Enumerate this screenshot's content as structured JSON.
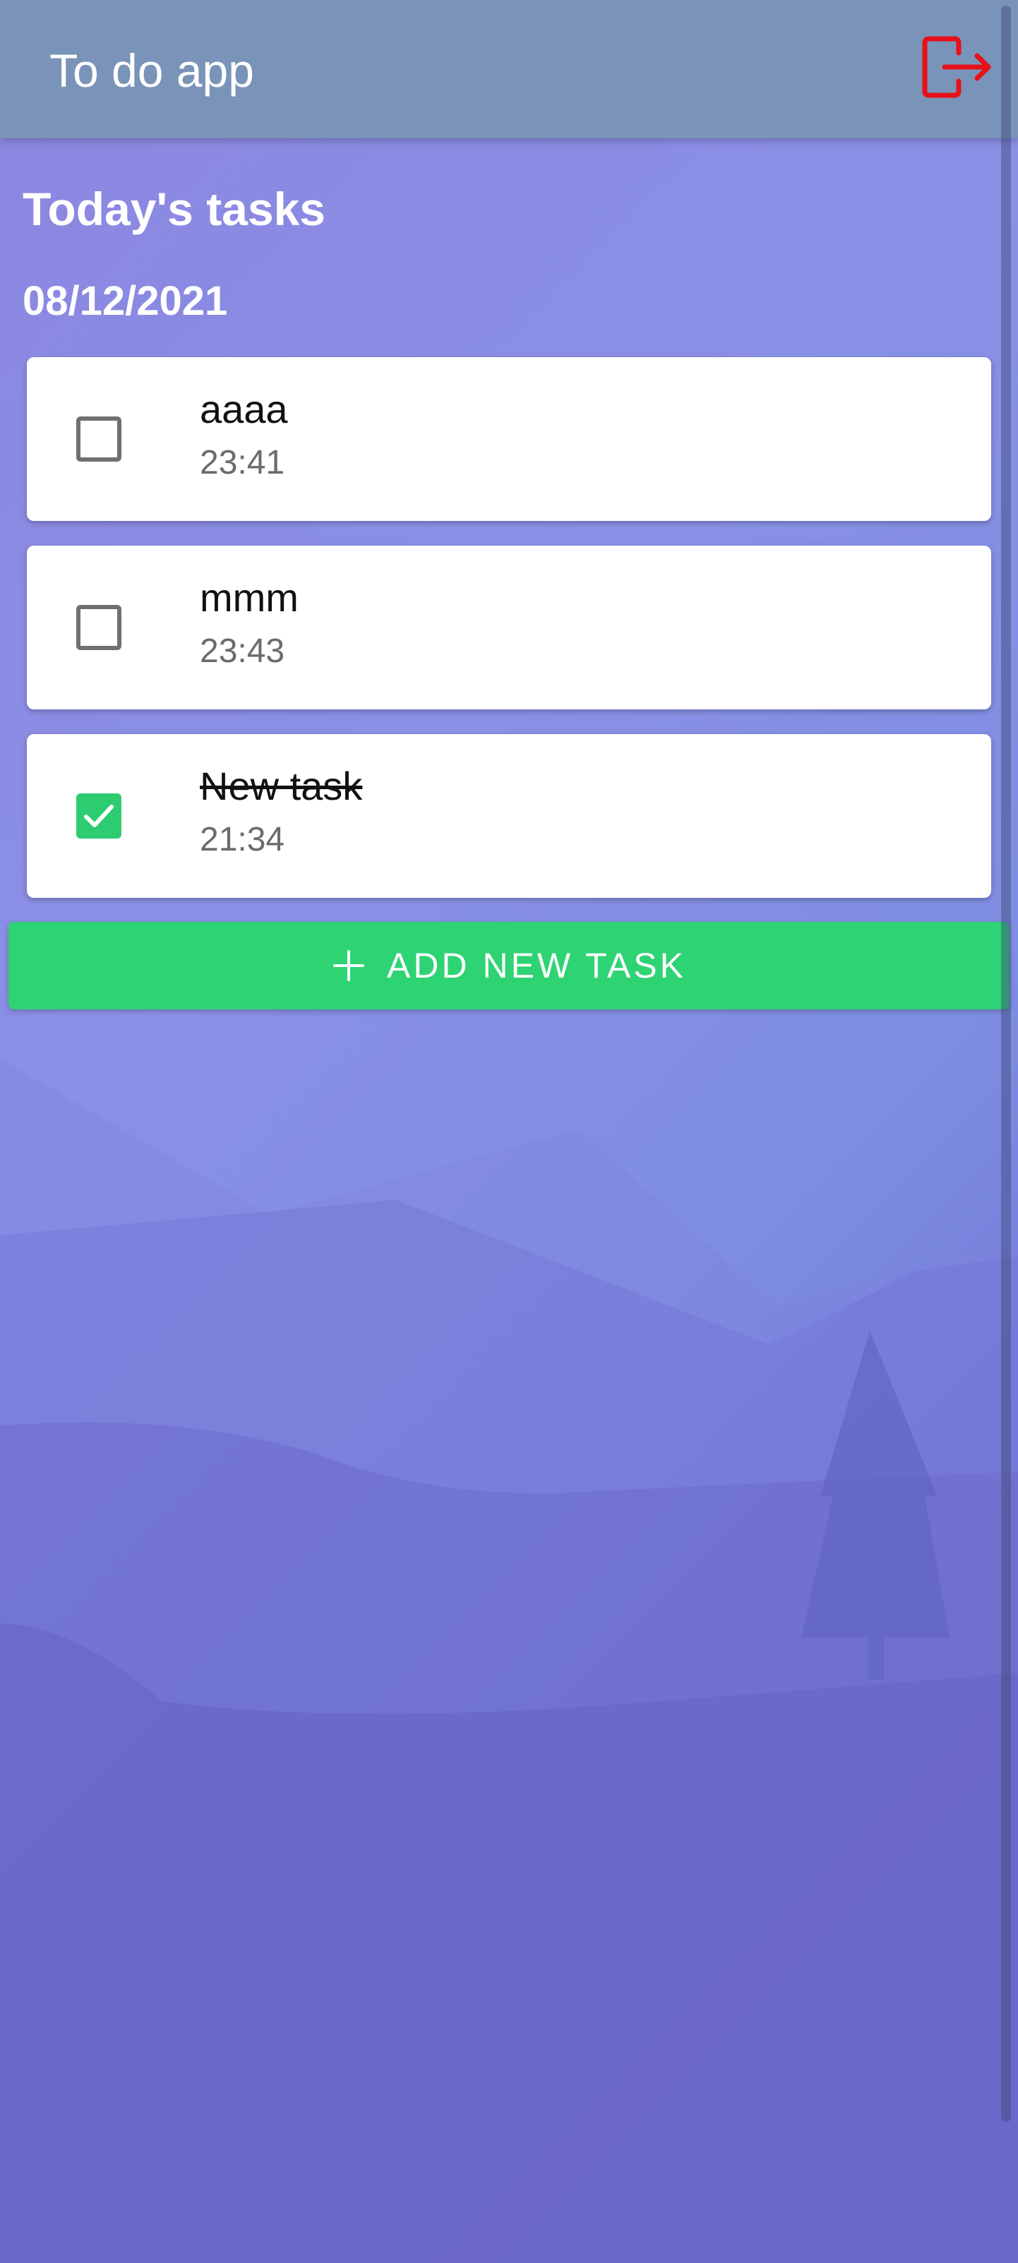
{
  "app": {
    "title": "To do app",
    "logout_icon": "logout-icon"
  },
  "tasks_section": {
    "title": "Today's tasks",
    "date": "08/12/2021"
  },
  "tasks": [
    {
      "name": "aaaa",
      "time": "23:41",
      "completed": false
    },
    {
      "name": "mmm",
      "time": "23:43",
      "completed": false
    },
    {
      "name": "New task",
      "time": "21:34",
      "completed": true
    }
  ],
  "add_button": {
    "label": "ADD NEW TASK",
    "icon": "plus-icon"
  },
  "colors": {
    "app_bar": "#7a93b8",
    "accent_green": "#2ed373",
    "logout_red": "#e8101a",
    "checkbox_border": "#707070"
  }
}
